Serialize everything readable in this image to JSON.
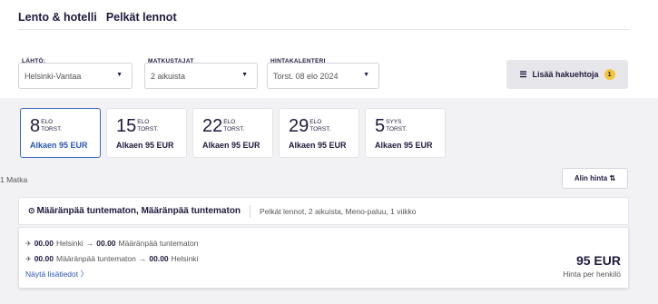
{
  "tabs": [
    {
      "label": "Lento & hotelli"
    },
    {
      "label": "Pelkät lennot"
    }
  ],
  "search": {
    "departure": {
      "label": "LÄHTÖ:",
      "value": "Helsinki-Vantaa"
    },
    "travelers": {
      "label": "MATKUSTAJAT",
      "value": "2 aikuista"
    },
    "calendar": {
      "label": "HINTAKALENTERI",
      "value": "Torst. 08 elo 2024"
    },
    "filters_label": "Lisää hakuehtoja",
    "filters_count": "1"
  },
  "dates": [
    {
      "day": "8",
      "month": "ELO",
      "weekday": "TORST.",
      "from": "Alkaen 95 EUR",
      "selected": true
    },
    {
      "day": "15",
      "month": "ELO",
      "weekday": "TORST.",
      "from": "Alkaen 95 EUR",
      "selected": false
    },
    {
      "day": "22",
      "month": "ELO",
      "weekday": "TORST.",
      "from": "Alkaen 95 EUR",
      "selected": false
    },
    {
      "day": "29",
      "month": "ELO",
      "weekday": "TORST.",
      "from": "Alkaen 95 EUR",
      "selected": false
    },
    {
      "day": "5",
      "month": "SYYS",
      "weekday": "TORST.",
      "from": "Alkaen 95 EUR",
      "selected": false
    }
  ],
  "results": {
    "count": "1 Matka",
    "sort_label": "Alin hinta ⇅"
  },
  "destination": {
    "title": "Määränpää tuntematon, Määränpää tuntematon",
    "summary": "Pelkät lennot, 2 aikuista, Meno-paluu, 1 viikko"
  },
  "flight": {
    "out": {
      "dep_time": "00.00",
      "dep_place": "Helsinki",
      "arr_time": "00.00",
      "arr_place": "Määränpää tuntematon"
    },
    "ret": {
      "dep_time": "00.00",
      "dep_place": "Määränpää tuntematon",
      "arr_time": "00.00",
      "arr_place": "Helsinki"
    },
    "details_label": "Näytä lisätiedot",
    "price": "95 EUR",
    "per_person": "Hinta per henkilö"
  },
  "icons": {
    "caret": "▼",
    "arrow": "→",
    "chevron": "〉",
    "plane": "✈",
    "pin": "⊙",
    "filters": "☰"
  },
  "colors": {
    "accent": "#2b57b5",
    "badge": "#f6c53a"
  }
}
